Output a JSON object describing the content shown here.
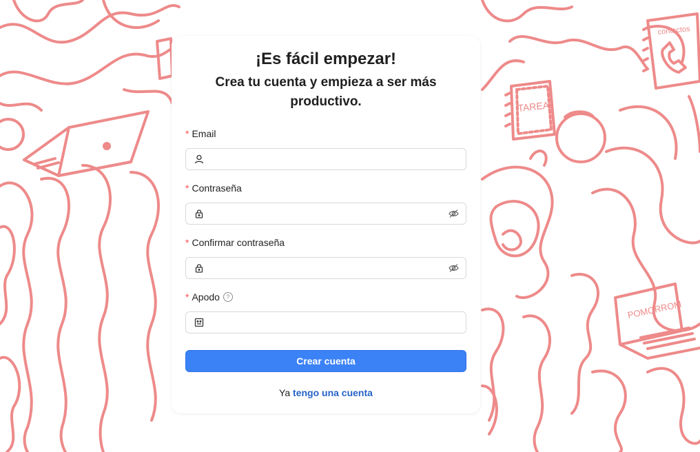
{
  "page": {
    "title": "¡Es fácil empezar!",
    "subtitle": "Crea tu cuenta y empieza a ser más productivo."
  },
  "form": {
    "required_mark": "*",
    "email": {
      "label": "Email",
      "value": "",
      "icon": "user-icon"
    },
    "password": {
      "label": "Contraseña",
      "value": "",
      "icon": "lock-icon",
      "toggle_icon": "eye-hidden-icon"
    },
    "confirm_password": {
      "label": "Confirmar contraseña",
      "value": "",
      "icon": "lock-icon",
      "toggle_icon": "eye-hidden-icon"
    },
    "nickname": {
      "label": "Apodo",
      "help": "?",
      "value": "",
      "icon": "id-card-icon"
    },
    "submit_label": "Crear cuenta"
  },
  "footer": {
    "prefix": "Ya",
    "link_label": "tengo una cuenta"
  },
  "background": {
    "doodle_labels": {
      "contacts": "contactos",
      "homework": "TAREA",
      "pomodoro": "POMORROM"
    },
    "stroke_color": "#ee8a8a"
  },
  "colors": {
    "accent": "#3b82f6",
    "link": "#2563c7",
    "required": "#ff4d4f"
  }
}
